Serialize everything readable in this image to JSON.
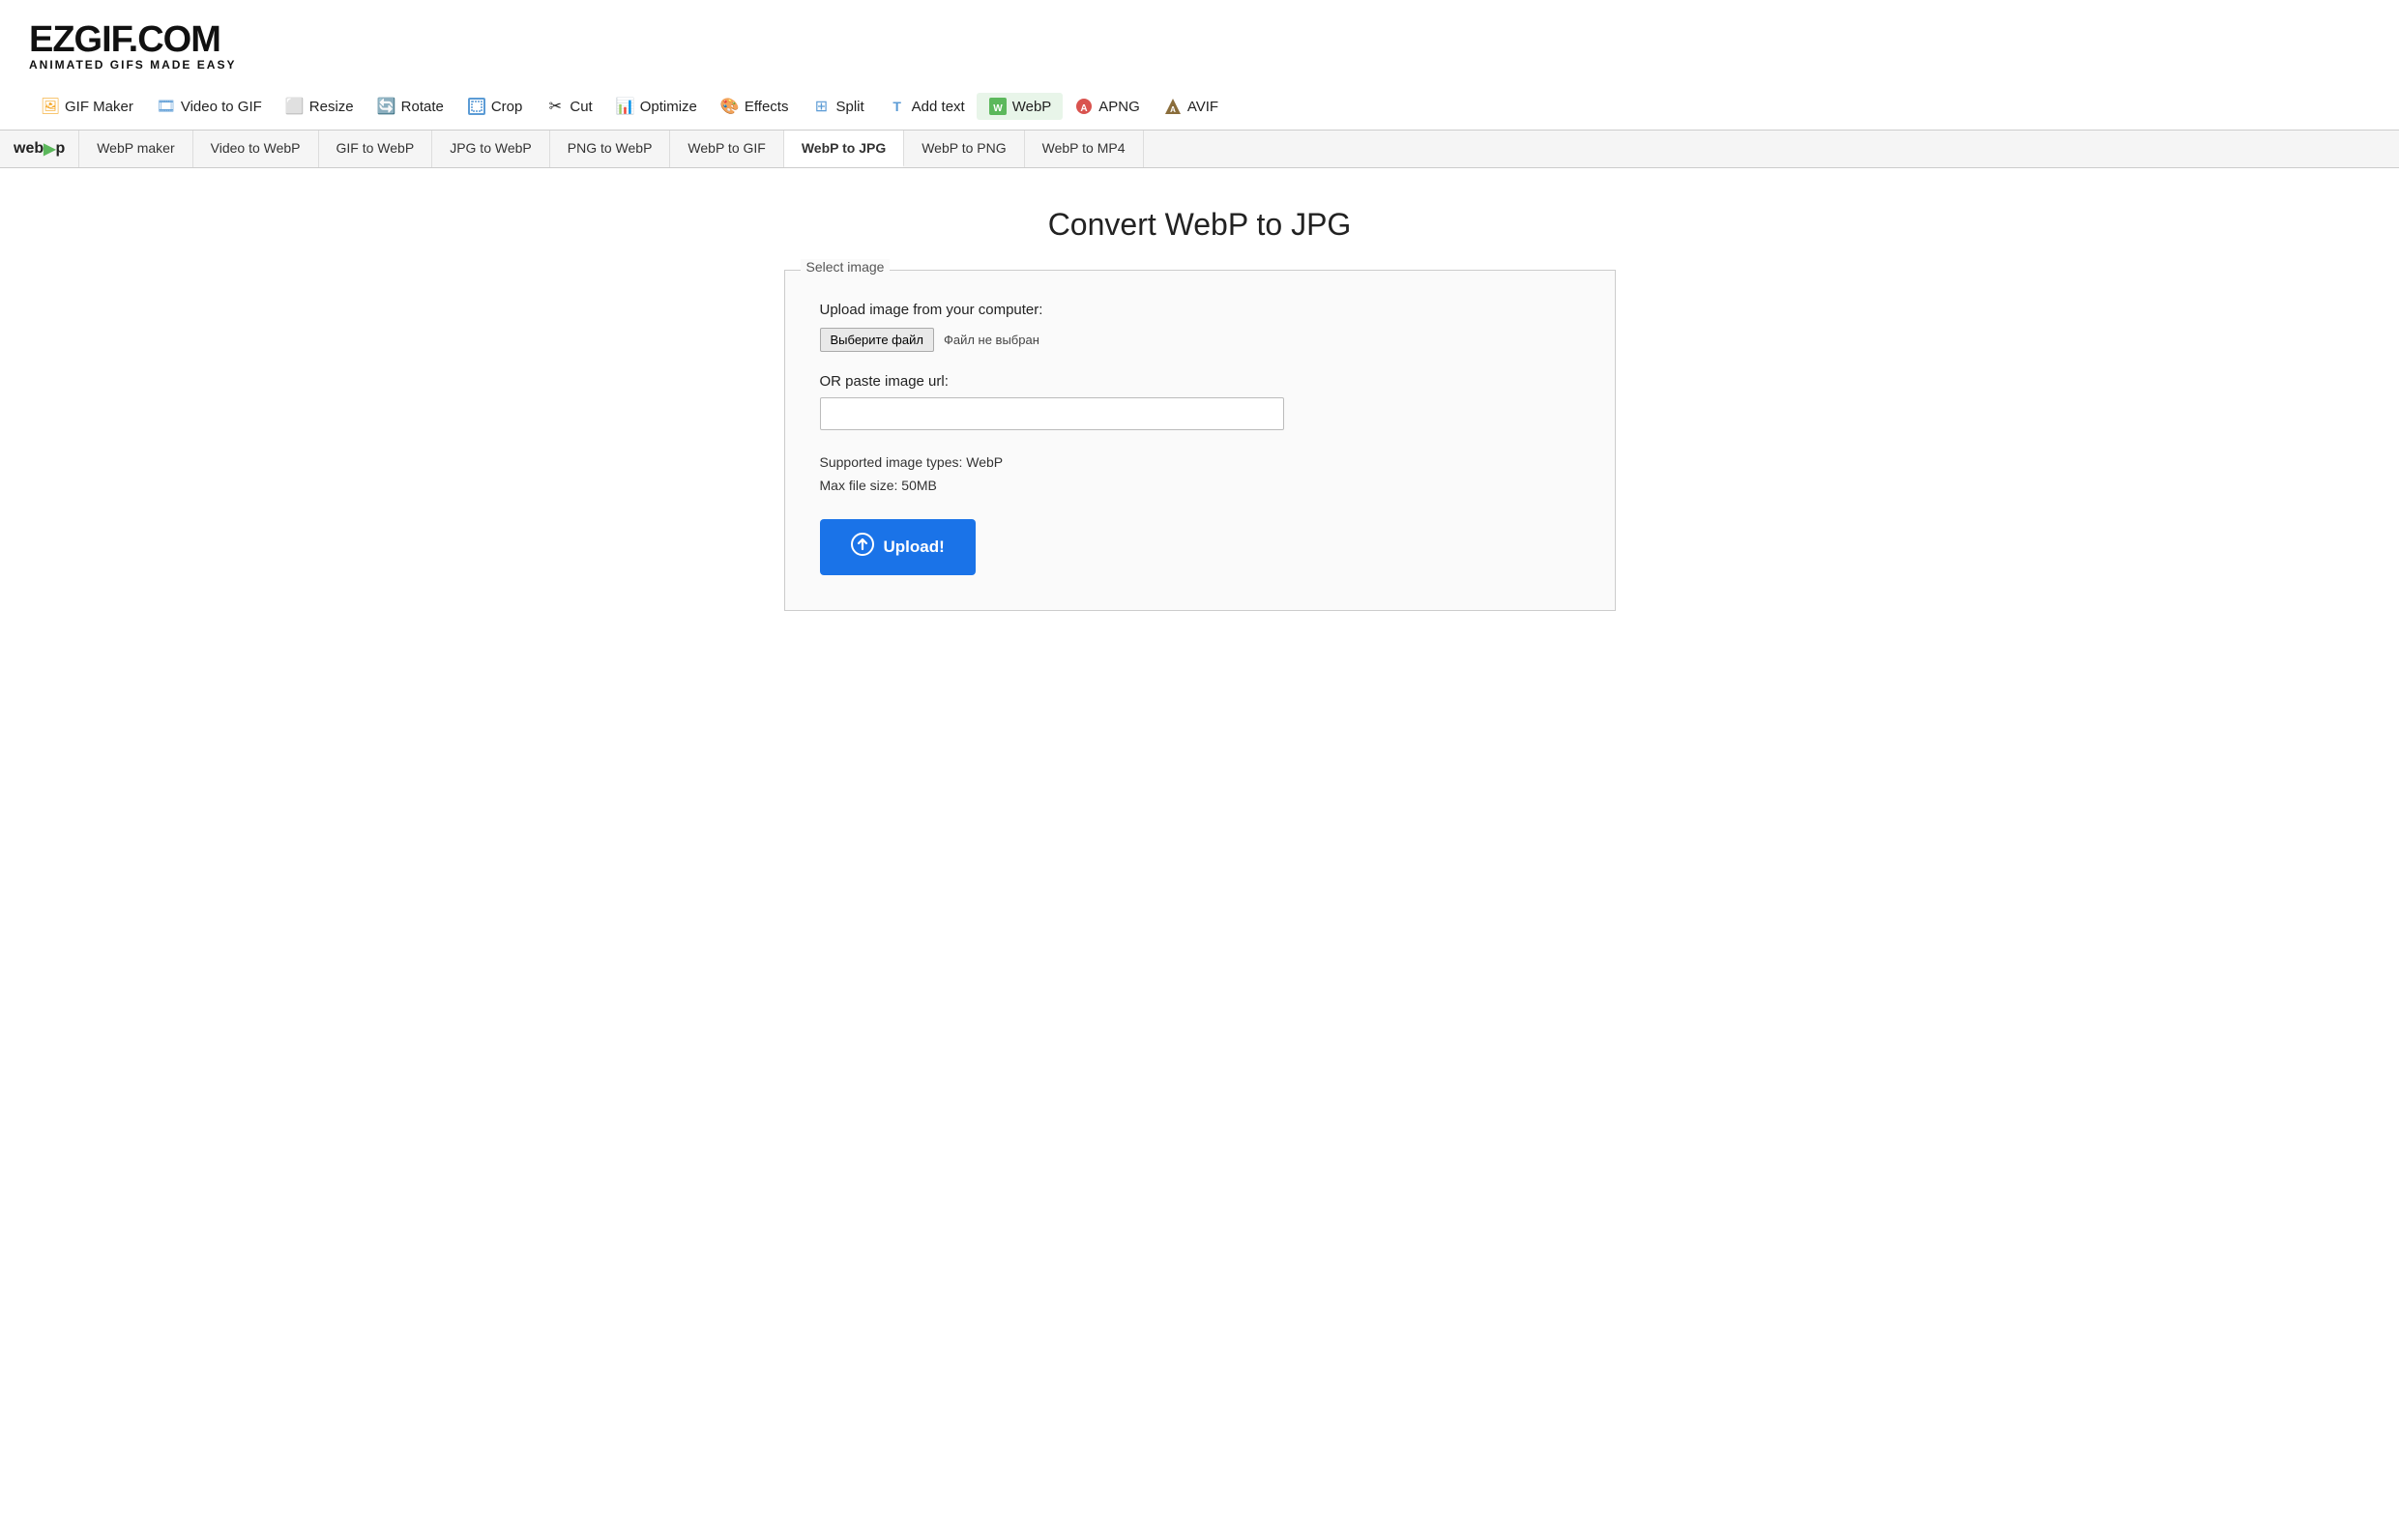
{
  "logo": {
    "main": "EZGIF.COM",
    "sub": "ANIMATED GIFS MADE EASY"
  },
  "nav": {
    "items": [
      {
        "id": "gif-maker",
        "label": "GIF Maker",
        "icon": "🖼"
      },
      {
        "id": "video-to-gif",
        "label": "Video to GIF",
        "icon": "🎞"
      },
      {
        "id": "resize",
        "label": "Resize",
        "icon": "⬜"
      },
      {
        "id": "rotate",
        "label": "Rotate",
        "icon": "🔄"
      },
      {
        "id": "crop",
        "label": "Crop",
        "icon": "⬛"
      },
      {
        "id": "cut",
        "label": "Cut",
        "icon": "✂"
      },
      {
        "id": "optimize",
        "label": "Optimize",
        "icon": "📊"
      },
      {
        "id": "effects",
        "label": "Effects",
        "icon": "🎨"
      },
      {
        "id": "split",
        "label": "Split",
        "icon": "⊞"
      },
      {
        "id": "add-text",
        "label": "Add text",
        "icon": "T"
      },
      {
        "id": "webp",
        "label": "WebP",
        "icon": "🟢"
      },
      {
        "id": "apng",
        "label": "APNG",
        "icon": "🔴"
      },
      {
        "id": "avif",
        "label": "AVIF",
        "icon": "🔺"
      }
    ]
  },
  "subnav": {
    "logo": "web▶p",
    "tabs": [
      {
        "id": "webp-maker",
        "label": "WebP maker",
        "active": false
      },
      {
        "id": "video-to-webp",
        "label": "Video to WebP",
        "active": false
      },
      {
        "id": "gif-to-webp",
        "label": "GIF to WebP",
        "active": false
      },
      {
        "id": "jpg-to-webp",
        "label": "JPG to WebP",
        "active": false
      },
      {
        "id": "png-to-webp",
        "label": "PNG to WebP",
        "active": false
      },
      {
        "id": "webp-to-gif",
        "label": "WebP to GIF",
        "active": false
      },
      {
        "id": "webp-to-jpg",
        "label": "WebP to JPG",
        "active": true
      },
      {
        "id": "webp-to-png",
        "label": "WebP to PNG",
        "active": false
      },
      {
        "id": "webp-to-mp4",
        "label": "WebP to MP4",
        "active": false
      }
    ]
  },
  "main": {
    "page_title": "Convert WebP to JPG",
    "upload_box": {
      "legend": "Select image",
      "upload_label": "Upload image from your computer:",
      "choose_file_btn": "Выберите файл",
      "no_file_text": "Файл не выбран",
      "or_paste_label": "OR paste image url:",
      "url_placeholder": "",
      "supported_types": "Supported image types: WebP",
      "max_file_size": "Max file size: 50MB",
      "upload_btn_label": "Upload!"
    }
  }
}
